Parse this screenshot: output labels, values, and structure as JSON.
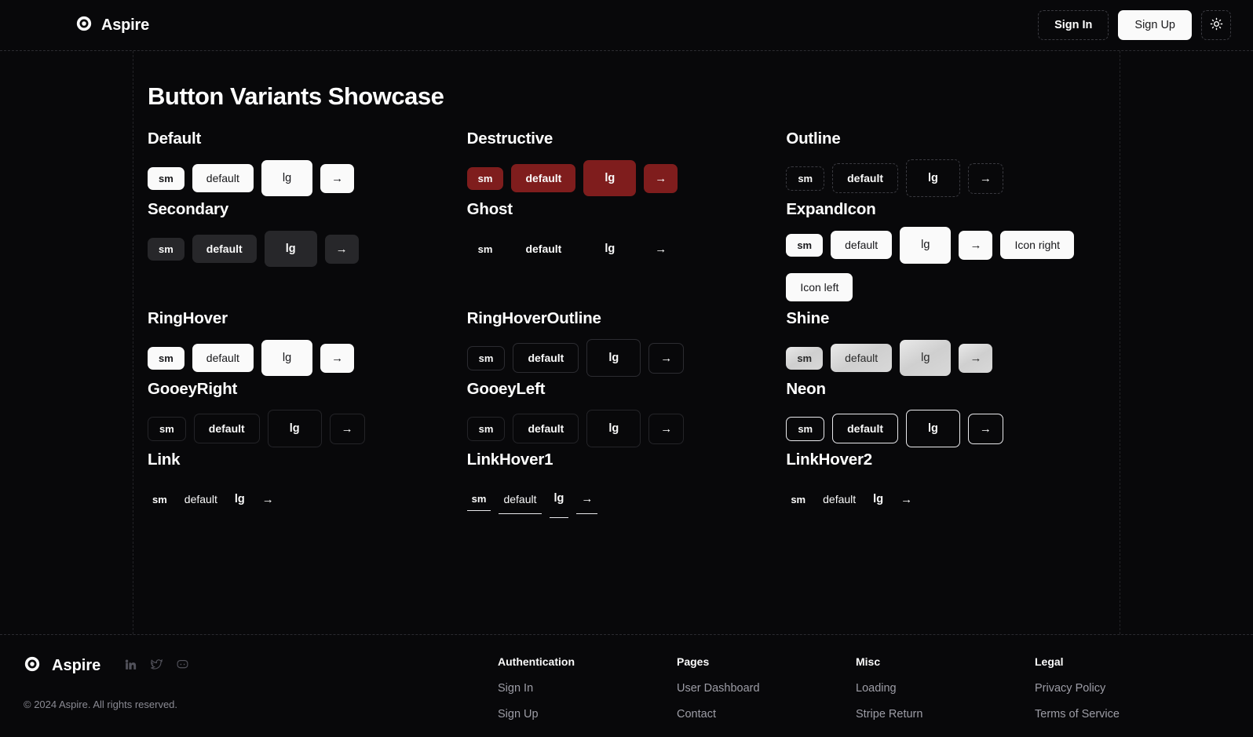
{
  "header": {
    "brand": "Aspire",
    "brand_icon": "target-icon",
    "sign_in": "Sign In",
    "sign_up": "Sign Up",
    "theme_toggle_icon": "sun-icon"
  },
  "main": {
    "title": "Button Variants Showcase",
    "sections": [
      {
        "title": "Default",
        "variant": "v-default",
        "buttons": [
          "sm",
          "default",
          "lg",
          "→"
        ]
      },
      {
        "title": "Destructive",
        "variant": "v-destructive",
        "buttons": [
          "sm",
          "default",
          "lg",
          "→"
        ]
      },
      {
        "title": "Outline",
        "variant": "v-outline",
        "buttons": [
          "sm",
          "default",
          "lg",
          "→"
        ]
      },
      {
        "title": "Secondary",
        "variant": "v-secondary",
        "buttons": [
          "sm",
          "default",
          "lg",
          "→"
        ]
      },
      {
        "title": "Ghost",
        "variant": "v-ghost",
        "buttons": [
          "sm",
          "default",
          "lg",
          "→"
        ]
      },
      {
        "title": "ExpandIcon",
        "variant": "v-expandicon",
        "buttons": [
          "sm",
          "default",
          "lg",
          "→",
          "Icon right",
          "Icon left"
        ]
      },
      {
        "title": "RingHover",
        "variant": "v-ringhover",
        "buttons": [
          "sm",
          "default",
          "lg",
          "→"
        ]
      },
      {
        "title": "RingHoverOutline",
        "variant": "v-ringhoveroutline",
        "buttons": [
          "sm",
          "default",
          "lg",
          "→"
        ]
      },
      {
        "title": "Shine",
        "variant": "v-shine",
        "buttons": [
          "sm",
          "default",
          "lg",
          "→"
        ]
      },
      {
        "title": "GooeyRight",
        "variant": "v-gooey",
        "buttons": [
          "sm",
          "default",
          "lg",
          "→"
        ]
      },
      {
        "title": "GooeyLeft",
        "variant": "v-gooey",
        "buttons": [
          "sm",
          "default",
          "lg",
          "→"
        ]
      },
      {
        "title": "Neon",
        "variant": "v-neon",
        "buttons": [
          "sm",
          "default",
          "lg",
          "→"
        ]
      },
      {
        "title": "Link",
        "variant": "v-link",
        "buttons": [
          "sm",
          "default",
          "lg",
          "→"
        ]
      },
      {
        "title": "LinkHover1",
        "variant": "v-linkhover1",
        "buttons": [
          "sm",
          "default",
          "lg",
          "→"
        ]
      },
      {
        "title": "LinkHover2",
        "variant": "v-link",
        "buttons": [
          "sm",
          "default",
          "lg",
          "→"
        ]
      }
    ]
  },
  "footer": {
    "brand": "Aspire",
    "brand_icon": "target-icon",
    "social": [
      "linkedin-icon",
      "twitter-icon",
      "discord-icon"
    ],
    "copyright": "© 2024 Aspire. All rights reserved.",
    "columns": [
      {
        "title": "Authentication",
        "links": [
          "Sign In",
          "Sign Up"
        ]
      },
      {
        "title": "Pages",
        "links": [
          "User Dashboard",
          "Contact"
        ]
      },
      {
        "title": "Misc",
        "links": [
          "Loading",
          "Stripe Return"
        ]
      },
      {
        "title": "Legal",
        "links": [
          "Privacy Policy",
          "Terms of Service"
        ]
      }
    ]
  },
  "colors": {
    "background": "#08080a",
    "foreground": "#fafafa",
    "destructive": "#7f1d1d",
    "secondary": "#27272a",
    "muted": "#9d9da6"
  }
}
